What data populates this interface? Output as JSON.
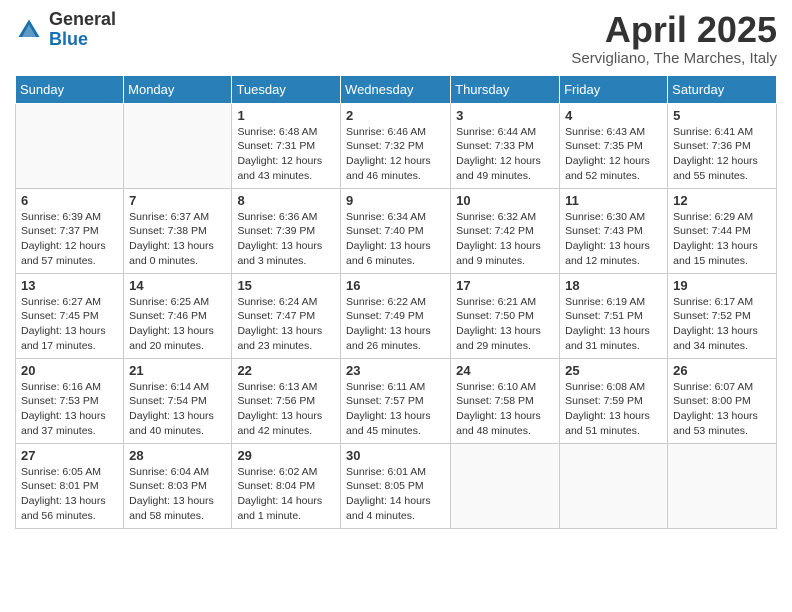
{
  "header": {
    "logo_general": "General",
    "logo_blue": "Blue",
    "month_title": "April 2025",
    "location": "Servigliano, The Marches, Italy"
  },
  "weekdays": [
    "Sunday",
    "Monday",
    "Tuesday",
    "Wednesday",
    "Thursday",
    "Friday",
    "Saturday"
  ],
  "weeks": [
    [
      {
        "day": "",
        "info": ""
      },
      {
        "day": "",
        "info": ""
      },
      {
        "day": "1",
        "info": "Sunrise: 6:48 AM\nSunset: 7:31 PM\nDaylight: 12 hours and 43 minutes."
      },
      {
        "day": "2",
        "info": "Sunrise: 6:46 AM\nSunset: 7:32 PM\nDaylight: 12 hours and 46 minutes."
      },
      {
        "day": "3",
        "info": "Sunrise: 6:44 AM\nSunset: 7:33 PM\nDaylight: 12 hours and 49 minutes."
      },
      {
        "day": "4",
        "info": "Sunrise: 6:43 AM\nSunset: 7:35 PM\nDaylight: 12 hours and 52 minutes."
      },
      {
        "day": "5",
        "info": "Sunrise: 6:41 AM\nSunset: 7:36 PM\nDaylight: 12 hours and 55 minutes."
      }
    ],
    [
      {
        "day": "6",
        "info": "Sunrise: 6:39 AM\nSunset: 7:37 PM\nDaylight: 12 hours and 57 minutes."
      },
      {
        "day": "7",
        "info": "Sunrise: 6:37 AM\nSunset: 7:38 PM\nDaylight: 13 hours and 0 minutes."
      },
      {
        "day": "8",
        "info": "Sunrise: 6:36 AM\nSunset: 7:39 PM\nDaylight: 13 hours and 3 minutes."
      },
      {
        "day": "9",
        "info": "Sunrise: 6:34 AM\nSunset: 7:40 PM\nDaylight: 13 hours and 6 minutes."
      },
      {
        "day": "10",
        "info": "Sunrise: 6:32 AM\nSunset: 7:42 PM\nDaylight: 13 hours and 9 minutes."
      },
      {
        "day": "11",
        "info": "Sunrise: 6:30 AM\nSunset: 7:43 PM\nDaylight: 13 hours and 12 minutes."
      },
      {
        "day": "12",
        "info": "Sunrise: 6:29 AM\nSunset: 7:44 PM\nDaylight: 13 hours and 15 minutes."
      }
    ],
    [
      {
        "day": "13",
        "info": "Sunrise: 6:27 AM\nSunset: 7:45 PM\nDaylight: 13 hours and 17 minutes."
      },
      {
        "day": "14",
        "info": "Sunrise: 6:25 AM\nSunset: 7:46 PM\nDaylight: 13 hours and 20 minutes."
      },
      {
        "day": "15",
        "info": "Sunrise: 6:24 AM\nSunset: 7:47 PM\nDaylight: 13 hours and 23 minutes."
      },
      {
        "day": "16",
        "info": "Sunrise: 6:22 AM\nSunset: 7:49 PM\nDaylight: 13 hours and 26 minutes."
      },
      {
        "day": "17",
        "info": "Sunrise: 6:21 AM\nSunset: 7:50 PM\nDaylight: 13 hours and 29 minutes."
      },
      {
        "day": "18",
        "info": "Sunrise: 6:19 AM\nSunset: 7:51 PM\nDaylight: 13 hours and 31 minutes."
      },
      {
        "day": "19",
        "info": "Sunrise: 6:17 AM\nSunset: 7:52 PM\nDaylight: 13 hours and 34 minutes."
      }
    ],
    [
      {
        "day": "20",
        "info": "Sunrise: 6:16 AM\nSunset: 7:53 PM\nDaylight: 13 hours and 37 minutes."
      },
      {
        "day": "21",
        "info": "Sunrise: 6:14 AM\nSunset: 7:54 PM\nDaylight: 13 hours and 40 minutes."
      },
      {
        "day": "22",
        "info": "Sunrise: 6:13 AM\nSunset: 7:56 PM\nDaylight: 13 hours and 42 minutes."
      },
      {
        "day": "23",
        "info": "Sunrise: 6:11 AM\nSunset: 7:57 PM\nDaylight: 13 hours and 45 minutes."
      },
      {
        "day": "24",
        "info": "Sunrise: 6:10 AM\nSunset: 7:58 PM\nDaylight: 13 hours and 48 minutes."
      },
      {
        "day": "25",
        "info": "Sunrise: 6:08 AM\nSunset: 7:59 PM\nDaylight: 13 hours and 51 minutes."
      },
      {
        "day": "26",
        "info": "Sunrise: 6:07 AM\nSunset: 8:00 PM\nDaylight: 13 hours and 53 minutes."
      }
    ],
    [
      {
        "day": "27",
        "info": "Sunrise: 6:05 AM\nSunset: 8:01 PM\nDaylight: 13 hours and 56 minutes."
      },
      {
        "day": "28",
        "info": "Sunrise: 6:04 AM\nSunset: 8:03 PM\nDaylight: 13 hours and 58 minutes."
      },
      {
        "day": "29",
        "info": "Sunrise: 6:02 AM\nSunset: 8:04 PM\nDaylight: 14 hours and 1 minute."
      },
      {
        "day": "30",
        "info": "Sunrise: 6:01 AM\nSunset: 8:05 PM\nDaylight: 14 hours and 4 minutes."
      },
      {
        "day": "",
        "info": ""
      },
      {
        "day": "",
        "info": ""
      },
      {
        "day": "",
        "info": ""
      }
    ]
  ]
}
